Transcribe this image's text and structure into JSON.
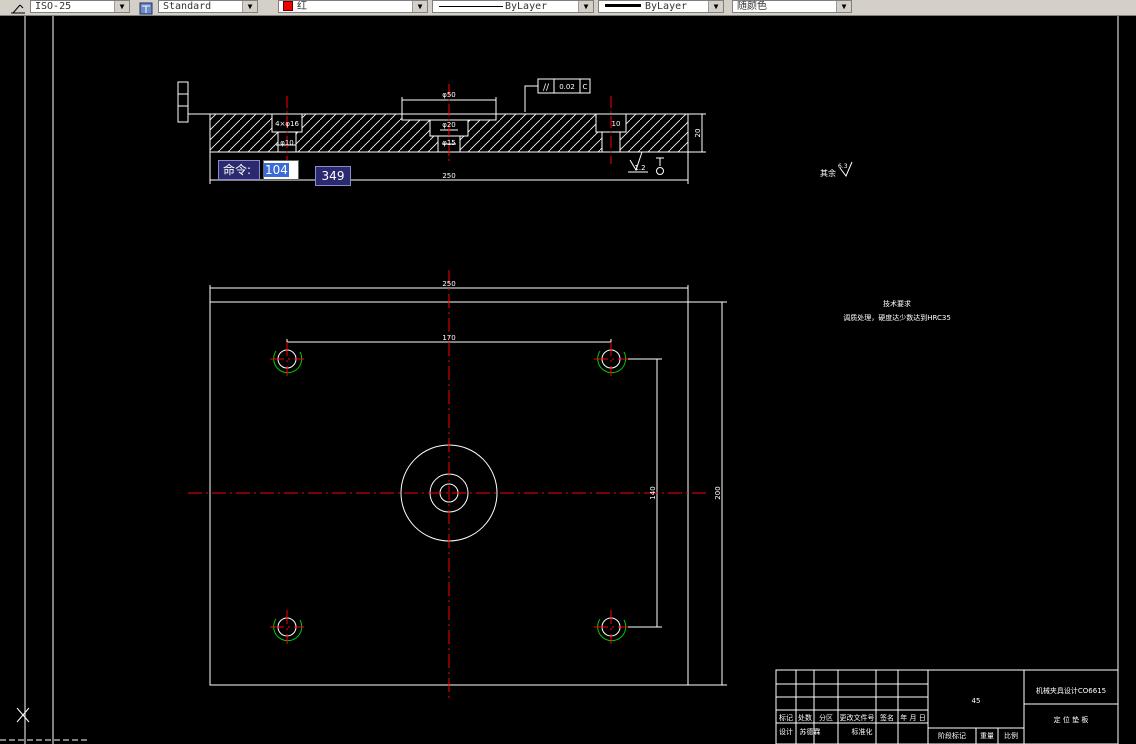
{
  "toolbar": {
    "dimstyle": "ISO-25",
    "textstyle": "Standard",
    "color": "红",
    "linetype": "ByLayer",
    "lineweight": "ByLayer",
    "plotstyle": "随颜色"
  },
  "command": {
    "label": "命令:",
    "input_value": "104",
    "coord_value": "349"
  },
  "dimensions": {
    "phi50": "φ50",
    "phi20": "φ20",
    "phi15": "φ15",
    "holes": "4×φ16",
    "phi10": "φ10",
    "d10": "10",
    "d20": "20",
    "width_side": "250",
    "width_top": "250",
    "d170": "170",
    "d140": "140",
    "d200": "200",
    "tolerance": "0.02",
    "datum": "C",
    "roughness": "1.2",
    "roughness_rest": "其余",
    "roughness_rest_value": "6.3"
  },
  "tech_requirements": {
    "title": "技术要求",
    "text": "调质处理，硬度达少数达到HRC35"
  },
  "title_block": {
    "material": "45",
    "drawing_name": "机械夹具设计CO6615",
    "part_name": "定 位 垫 板",
    "headers": [
      "标记",
      "处数",
      "分区",
      "更改文件号",
      "签名",
      "年 月 日"
    ],
    "design_label": "设计",
    "design_name": "苏德霖",
    "standard_label": "标准化",
    "stage_label": "阶段标记",
    "weight_label": "重量",
    "scale_label": "比例"
  },
  "colors": {
    "white": "#ffffff",
    "red": "#ff0000",
    "green": "#00cc00",
    "toolbar_bg": "#d4d0c8"
  }
}
